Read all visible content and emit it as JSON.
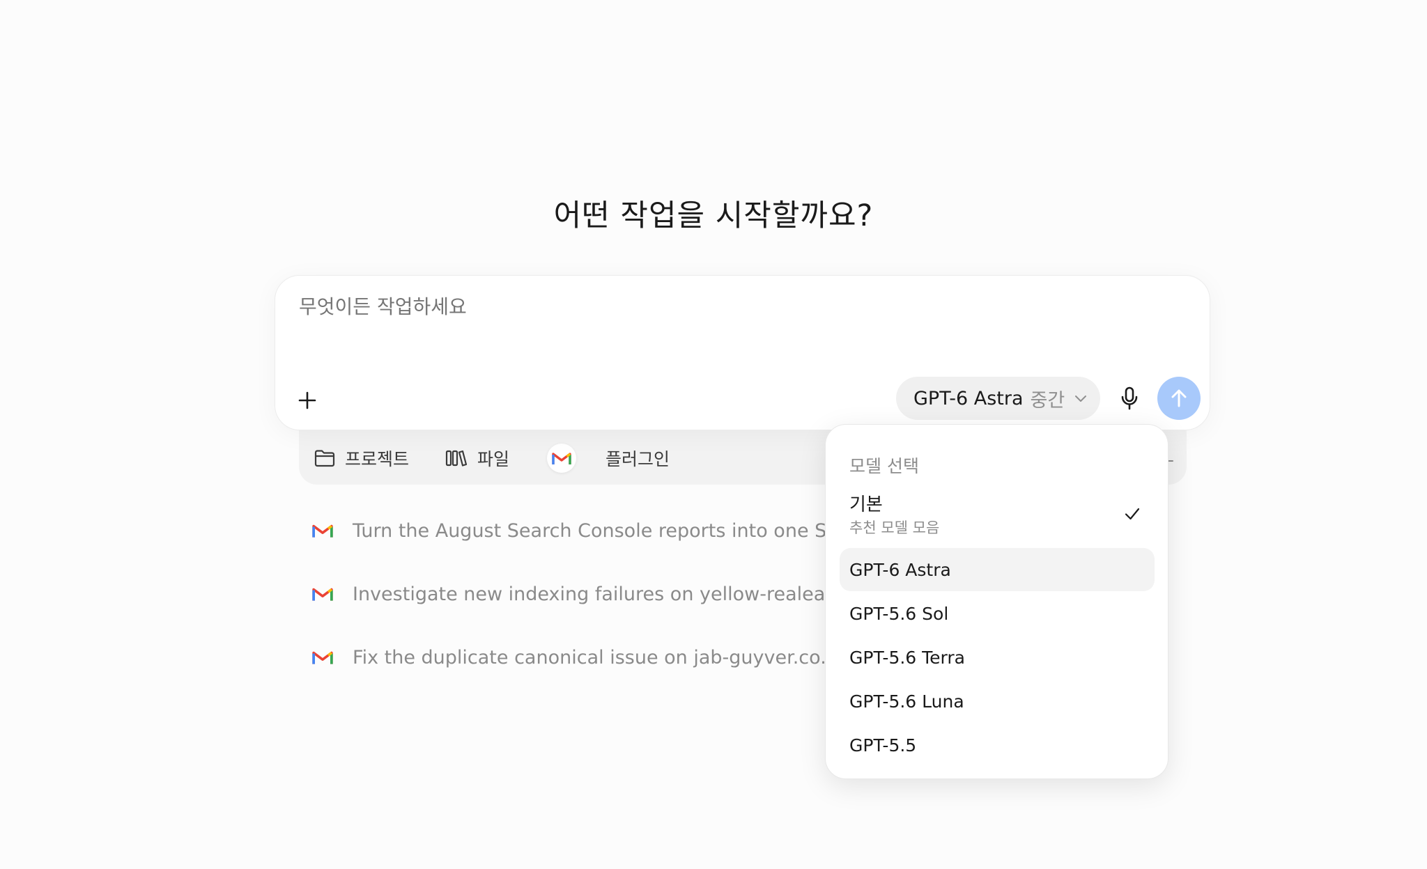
{
  "heading": "어떤 작업을 시작할까요?",
  "composer": {
    "placeholder": "무엇이든 작업하세요",
    "model_name": "GPT-6 Astra",
    "model_effort": "중간"
  },
  "tray": {
    "projects_label": "프로젝트",
    "files_label": "파일",
    "plugins_label": "플러그인"
  },
  "suggestions": [
    "Turn the August Search Console reports into one SEO",
    "Investigate new indexing failures on yellow-realeatate",
    "Fix the duplicate canonical issue on jab-guyver.co.kr"
  ],
  "model_menu": {
    "title": "모델 선택",
    "default_name": "기본",
    "default_sub": "추천 모델 모음",
    "default_selected": true,
    "items": [
      "GPT-6 Astra",
      "GPT-5.6 Sol",
      "GPT-5.6 Terra",
      "GPT-5.6 Luna",
      "GPT-5.5"
    ],
    "highlighted_item": "GPT-6 Astra"
  },
  "icons": {
    "attach": "plus-icon",
    "model_chevron": "chevron-down-icon",
    "voice": "microphone-icon",
    "send": "arrow-up-icon",
    "projects": "folder-icon",
    "files": "library-icon",
    "plugins": "gmail-icon",
    "selected": "checkmark-icon"
  },
  "colors": {
    "background": "#fcfcfc",
    "send_button": "#a8c9fb",
    "highlight": "#f3f3f3",
    "placeholder_text": "#8f8f8f"
  }
}
